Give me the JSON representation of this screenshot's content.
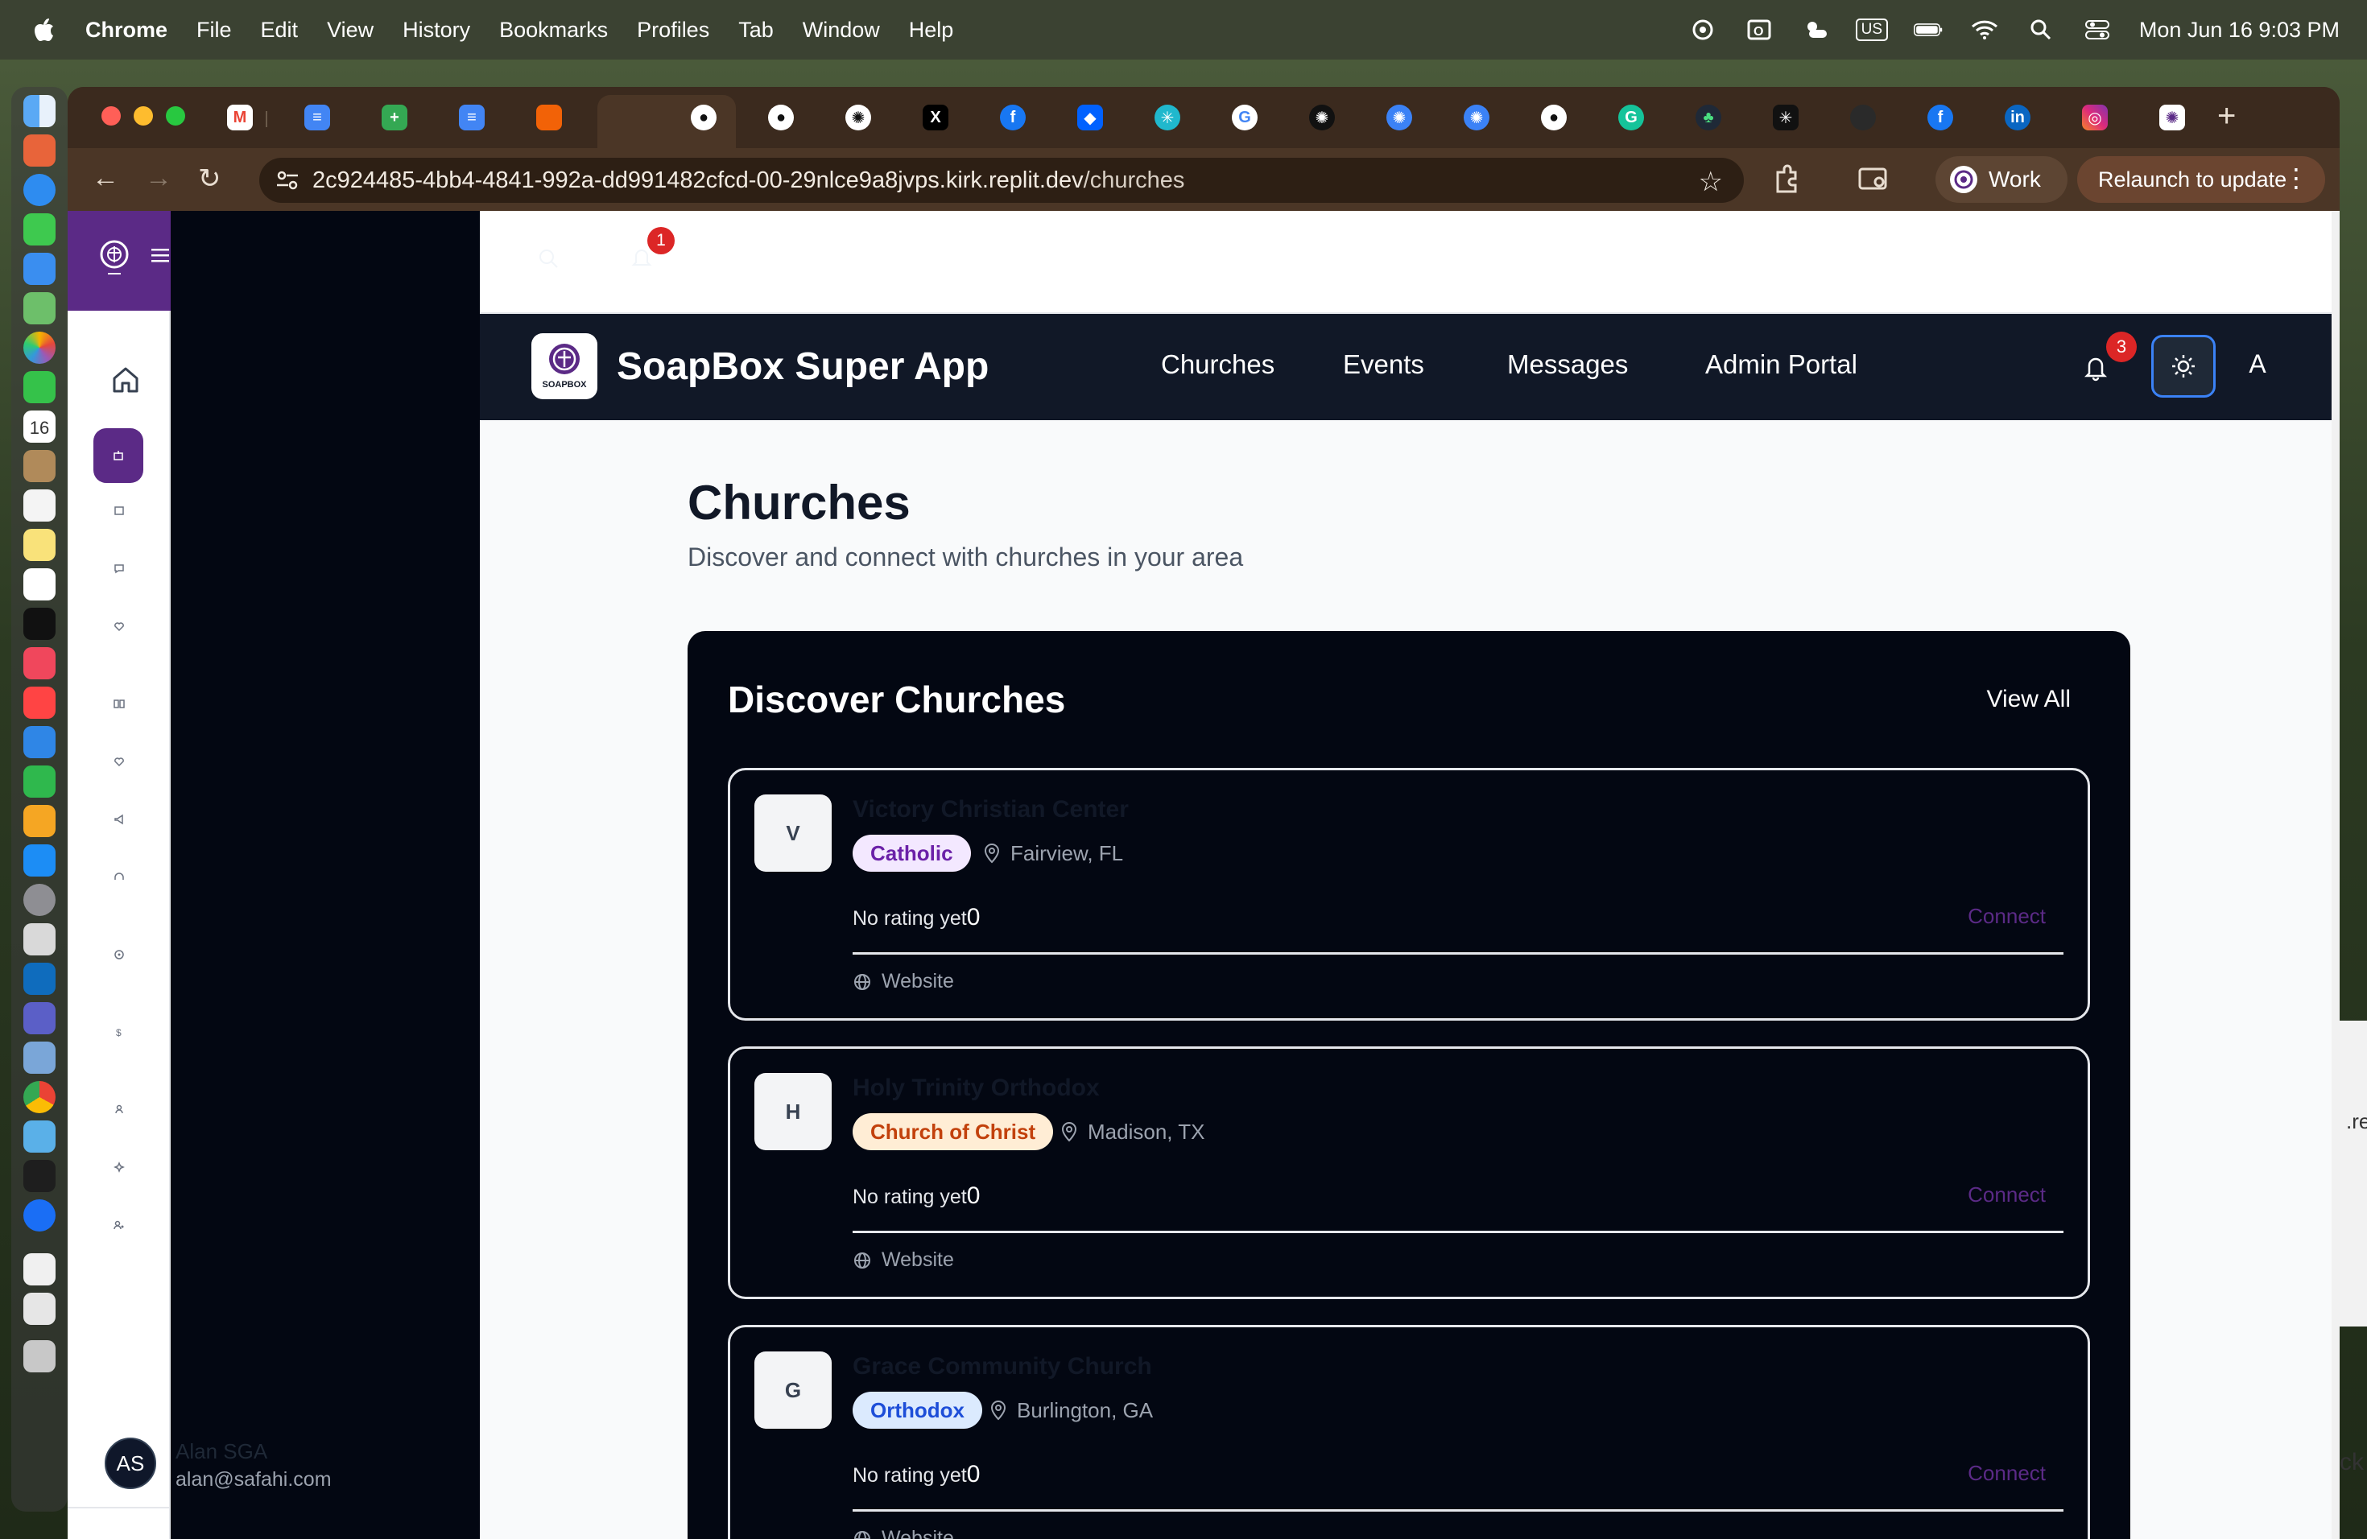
{
  "menubar": {
    "app": "Chrome",
    "items": [
      "File",
      "Edit",
      "View",
      "History",
      "Bookmarks",
      "Profiles",
      "Tab",
      "Window",
      "Help"
    ],
    "keyboard": "US",
    "clock": "Mon Jun 16  9:03 PM"
  },
  "browser": {
    "url_host": "2c924485-4bb4-4841-992a-dd991482cfcd-00-29nlce9a8jvps.kirk.replit.dev",
    "url_path": "/churches",
    "profile": "Work",
    "relaunch": "Relaunch to update"
  },
  "top_strip": {
    "badge_count": "1"
  },
  "header": {
    "logo_text": "SOAPBOX",
    "title": "SoapBox Super App",
    "nav": [
      "Churches",
      "Events",
      "Messages",
      "Admin Portal"
    ],
    "notifications": "3",
    "avatar_initial": "A"
  },
  "user": {
    "initials": "AS",
    "name": "Alan SGA",
    "email": "alan@safahi.com"
  },
  "page": {
    "title": "Churches",
    "subtitle": "Discover and connect with churches in your area"
  },
  "discover": {
    "title": "Discover Churches",
    "view_all": "View All",
    "churches": [
      {
        "initial": "V",
        "name": "Victory Christian Center",
        "denomination": "Catholic",
        "location": "Fairview, FL",
        "rating": "No rating yet",
        "count": "0",
        "connect": "Connect",
        "website": "Website"
      },
      {
        "initial": "H",
        "name": "Holy Trinity Orthodox",
        "denomination": "Church of Christ",
        "location": "Madison, TX",
        "rating": "No rating yet",
        "count": "0",
        "connect": "Connect",
        "website": "Website"
      },
      {
        "initial": "G",
        "name": "Grace Community Church",
        "denomination": "Orthodox",
        "location": "Burlington, GA",
        "rating": "No rating yet",
        "count": "0",
        "connect": "Connect",
        "website": "Website"
      }
    ]
  },
  "colors": {
    "brand_purple": "#5b2a86",
    "header_bg": "#111827",
    "panel_bg": "#030712",
    "badge_red": "#dc2626",
    "focus_blue": "#3b82f6"
  },
  "background_window": {
    "text1": ".re",
    "text2": "ck"
  }
}
